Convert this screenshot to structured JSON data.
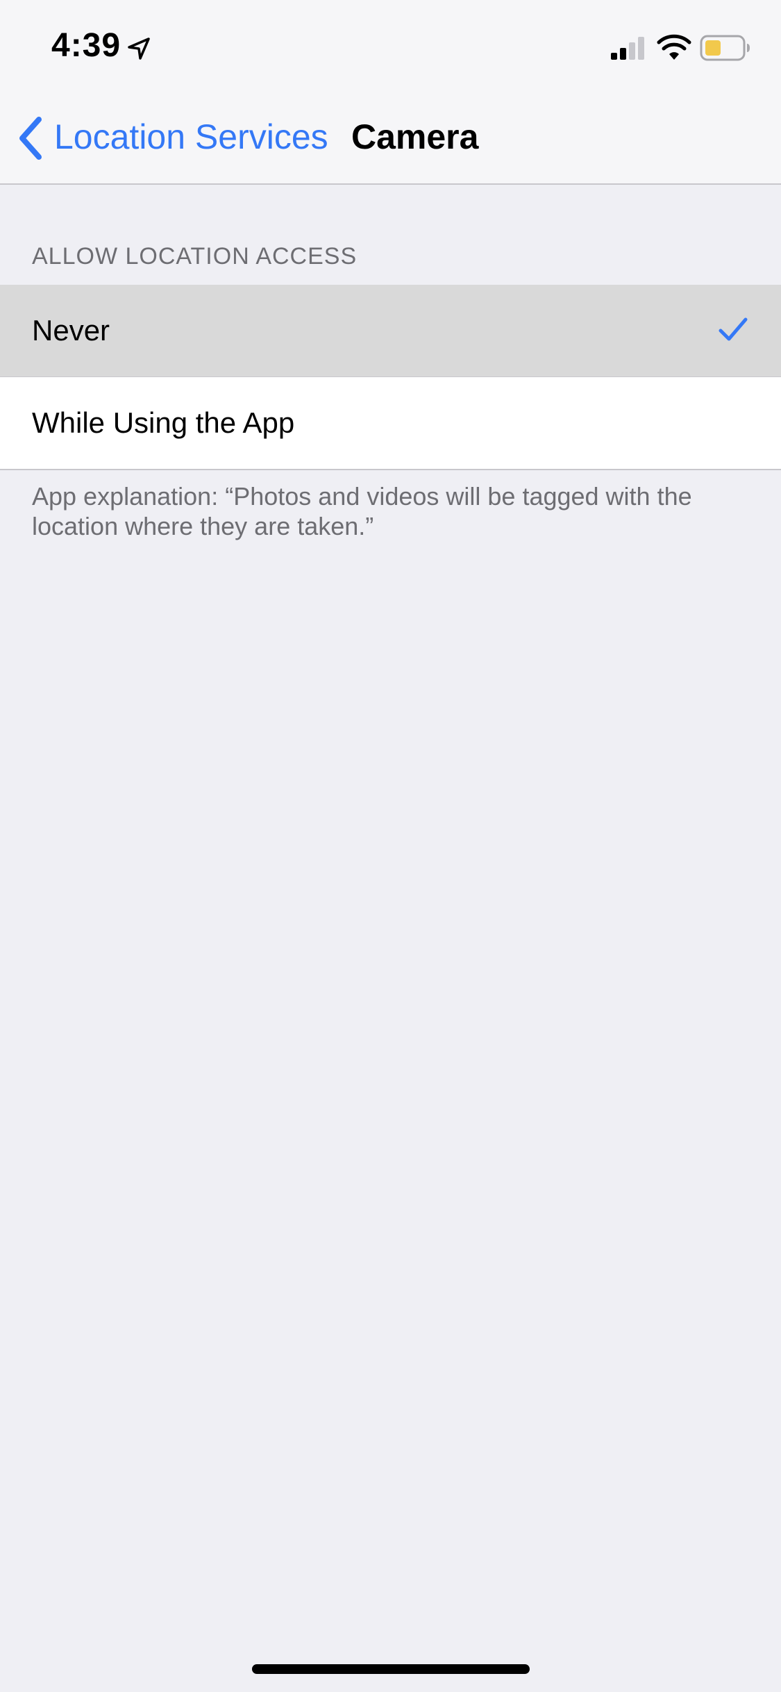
{
  "status_bar": {
    "time": "4:39",
    "location_icon": "location-arrow-icon",
    "signal_icon": "cellular-signal-icon",
    "wifi_icon": "wifi-icon",
    "battery_icon": "battery-icon",
    "battery_fill_color": "#f2c94c"
  },
  "nav": {
    "back_label": "Location Services",
    "back_icon": "chevron-left-icon",
    "title": "Camera"
  },
  "section": {
    "header": "ALLOW LOCATION ACCESS",
    "options": [
      {
        "label": "Never",
        "selected": true
      },
      {
        "label": "While Using the App",
        "selected": false
      }
    ],
    "footer": "App explanation: “Photos and videos will be tagged with the location where they are taken.”"
  },
  "colors": {
    "accent": "#3478f6",
    "background": "#efeff4",
    "selected_row": "#d9d9d9",
    "secondary_text": "#6d6d72"
  }
}
